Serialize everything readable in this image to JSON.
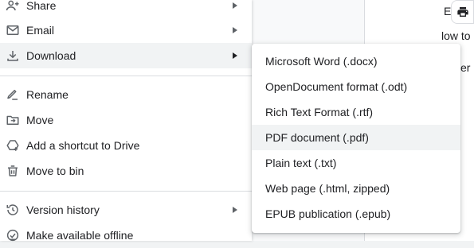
{
  "file_menu": {
    "items": [
      {
        "label": "Share",
        "icon": "person-add-icon",
        "submenu": true
      },
      {
        "label": "Email",
        "icon": "email-icon",
        "submenu": true
      },
      {
        "label": "Download",
        "icon": "download-icon",
        "submenu": true,
        "active": true
      },
      {
        "label": "Rename",
        "icon": "rename-icon",
        "submenu": false
      },
      {
        "label": "Move",
        "icon": "move-folder-icon",
        "submenu": false
      },
      {
        "label": "Add a shortcut to Drive",
        "icon": "add-shortcut-icon",
        "submenu": false
      },
      {
        "label": "Move to bin",
        "icon": "trash-icon",
        "submenu": false
      },
      {
        "label": "Version history",
        "icon": "history-icon",
        "submenu": true
      },
      {
        "label": "Make available offline",
        "icon": "offline-icon",
        "submenu": false
      }
    ]
  },
  "download_submenu": {
    "items": [
      {
        "label": "Microsoft Word (.docx)"
      },
      {
        "label": "OpenDocument format (.odt)"
      },
      {
        "label": "Rich Text Format (.rtf)"
      },
      {
        "label": "PDF document (.pdf)",
        "hover": true
      },
      {
        "label": "Plain text (.txt)"
      },
      {
        "label": "Web page (.html, zipped)"
      },
      {
        "label": "EPUB publication (.epub)"
      }
    ]
  },
  "document": {
    "fragment_1": "E",
    "fragment_2": "low to",
    "fragment_3": "er"
  },
  "colors": {
    "menu_bg": "#ffffff",
    "hover_bg": "#f1f3f4",
    "icon": "#5f6368",
    "text": "#202124",
    "divider": "#dadce0"
  }
}
